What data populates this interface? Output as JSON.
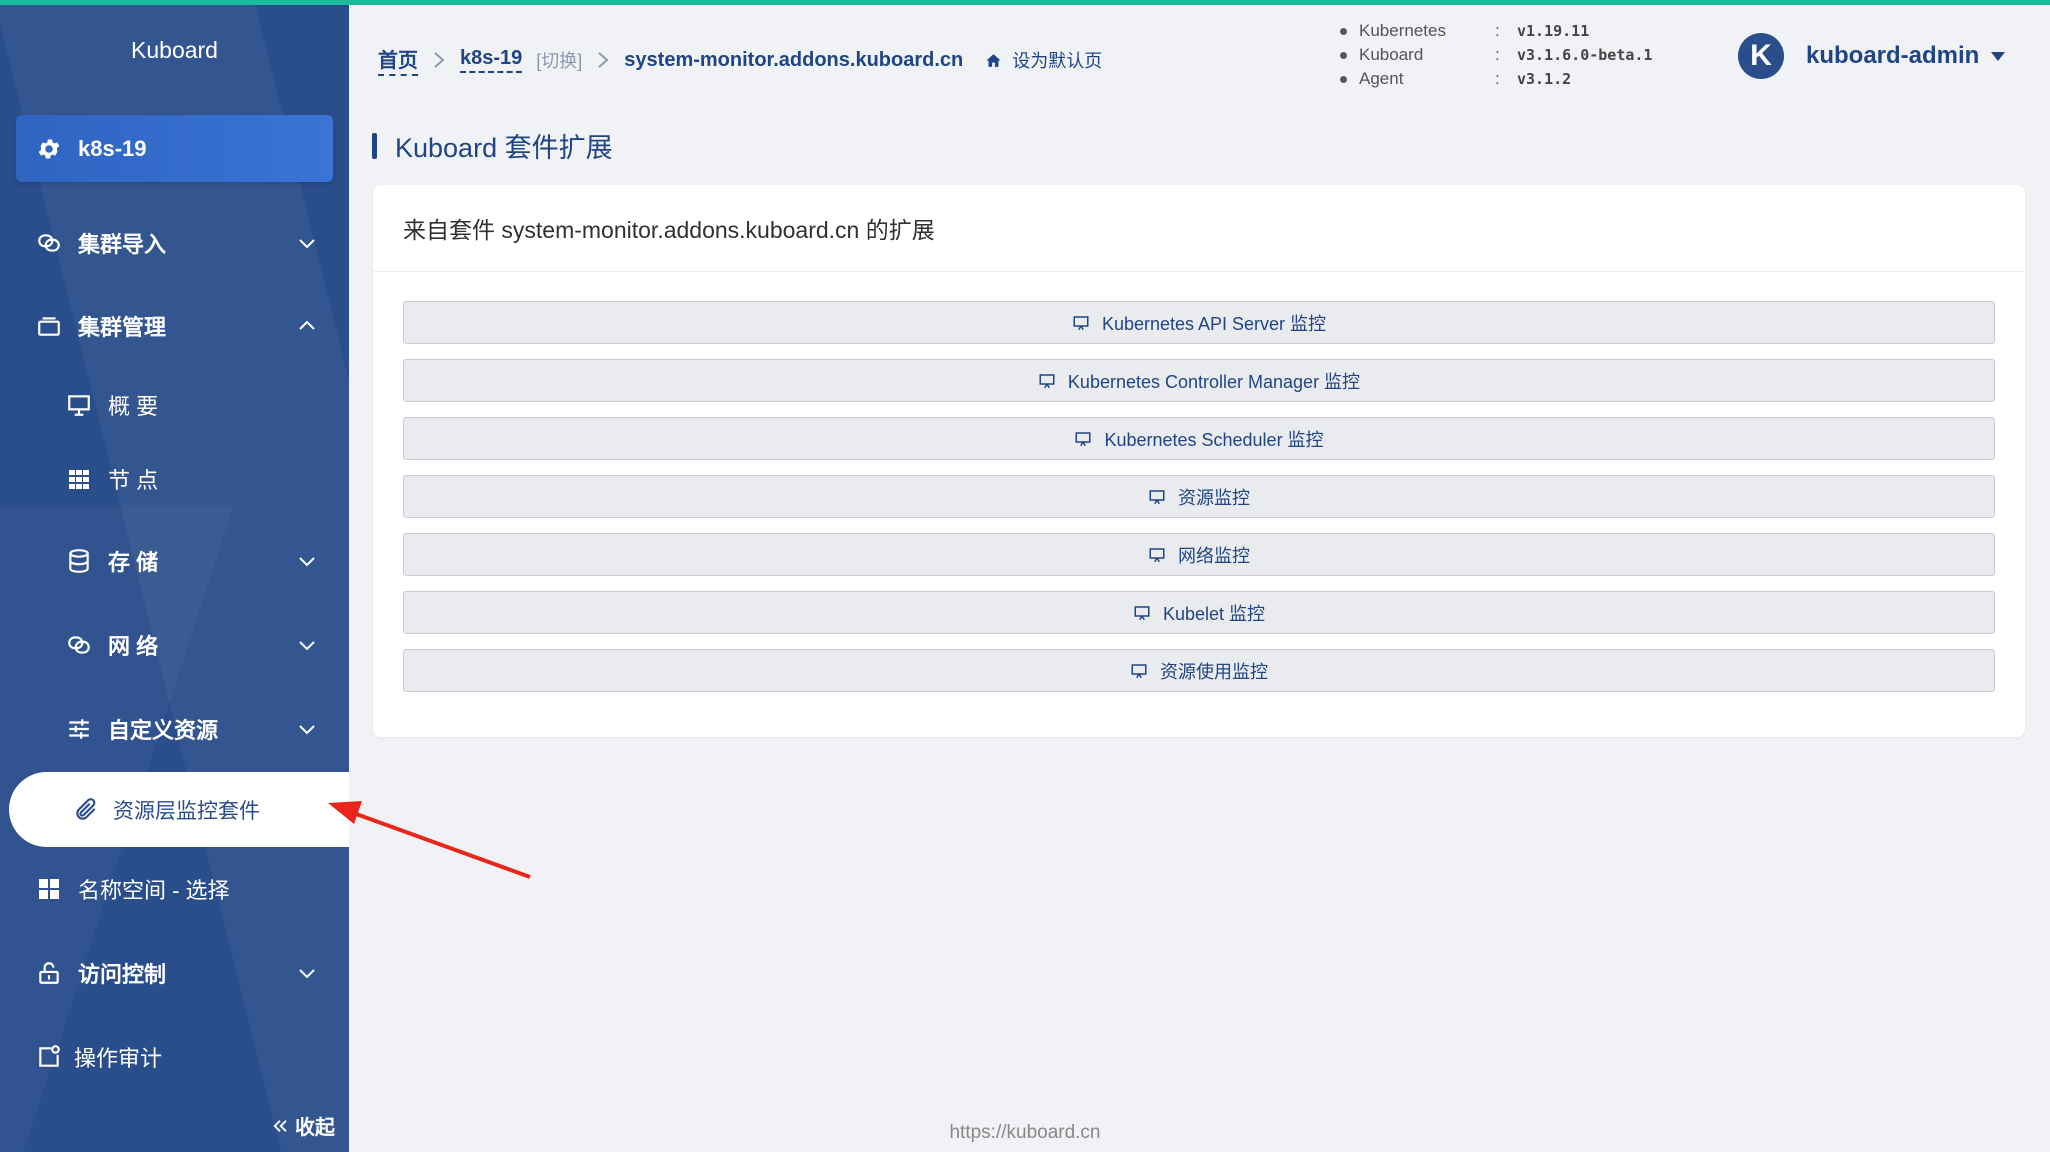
{
  "sidebar": {
    "logo": "Kuboard",
    "cluster_name": "k8s-19",
    "items": [
      {
        "label": "集群导入"
      },
      {
        "label": "集群管理"
      },
      {
        "label": "概 要"
      },
      {
        "label": "节 点"
      },
      {
        "label": "存 储"
      },
      {
        "label": "网 络"
      },
      {
        "label": "自定义资源"
      },
      {
        "label": "资源层监控套件"
      },
      {
        "label": "名称空间 - 选择"
      },
      {
        "label": "访问控制"
      },
      {
        "label": "操作审计"
      }
    ],
    "collapse_label": "收起"
  },
  "header": {
    "breadcrumb": {
      "home": "首页",
      "cluster": "k8s-19",
      "switch": "[切换]",
      "current": "system-monitor.addons.kuboard.cn",
      "set_default": "设为默认页"
    },
    "versions": [
      {
        "name": "Kubernetes",
        "sep": ":",
        "value": "v1.19.11"
      },
      {
        "name": "Kuboard",
        "sep": ":",
        "value": "v3.1.6.0-beta.1"
      },
      {
        "name": "Agent",
        "sep": ":",
        "value": "v3.1.2"
      }
    ],
    "user": {
      "avatar_letter": "K",
      "name": "kuboard-admin"
    }
  },
  "main": {
    "title": "Kuboard 套件扩展",
    "card_title": "来自套件 system-monitor.addons.kuboard.cn 的扩展",
    "buttons": [
      {
        "label": "Kubernetes API Server 监控"
      },
      {
        "label": "Kubernetes Controller Manager 监控"
      },
      {
        "label": "Kubernetes Scheduler 监控"
      },
      {
        "label": "资源监控"
      },
      {
        "label": "网络监控"
      },
      {
        "label": "Kubelet 监控"
      },
      {
        "label": "资源使用监控"
      }
    ]
  },
  "footer": {
    "url": "https://kuboard.cn"
  },
  "colors": {
    "sidebar": "#2a4d8b",
    "accent": "#1f4584",
    "top_bar": "#1abc9c",
    "arrow": "#e8261c"
  }
}
